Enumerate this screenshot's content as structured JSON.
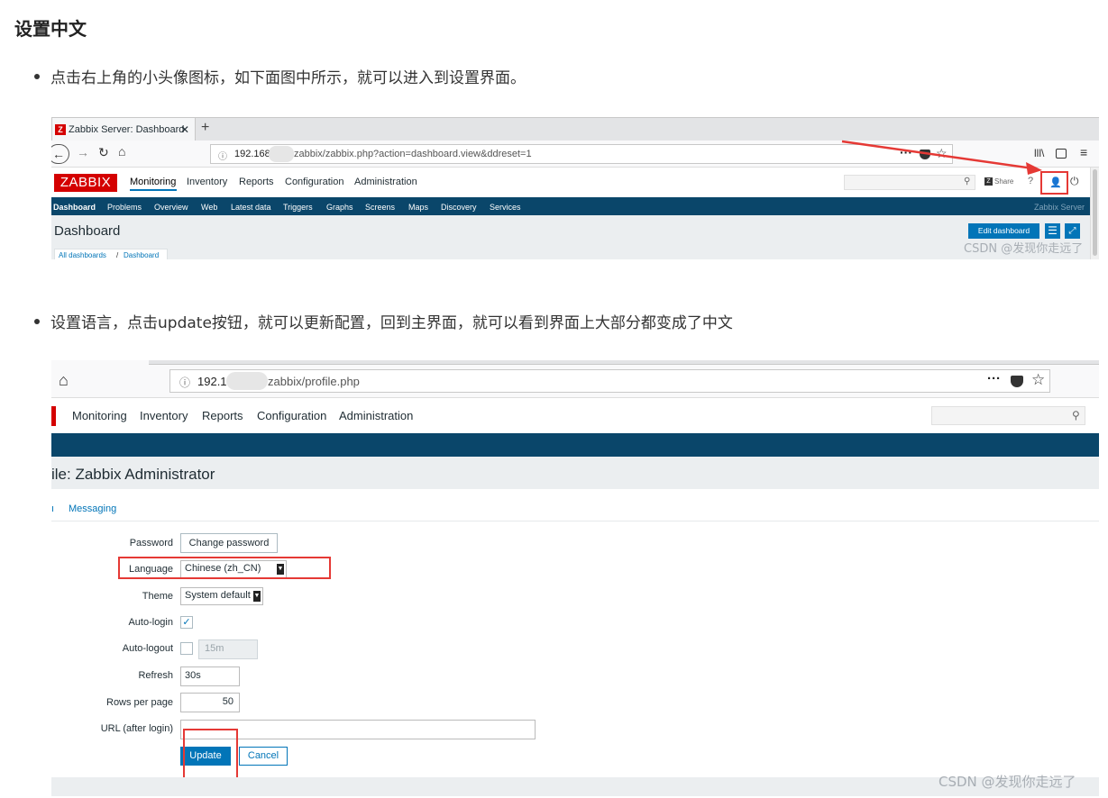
{
  "article": {
    "heading": "设置中文",
    "bullet1": "点击右上角的小头像图标，如下面图中所示，就可以进入到设置界面。",
    "bullet2": "设置语言，点击update按钮，就可以更新配置，回到主界面，就可以看到界面上大部分都变成了中文",
    "watermark": "CSDN @发现你走远了"
  },
  "shot1": {
    "tab_title": "Zabbix Server: Dashboard",
    "tab_close": "✕",
    "tab_new": "+",
    "url_host": "192.168",
    "url_path": "zabbix/zabbix.php?action=dashboard.view&ddreset=1",
    "url_more": "···",
    "logo": "ZABBIX",
    "nav": [
      "Monitoring",
      "Inventory",
      "Reports",
      "Configuration",
      "Administration"
    ],
    "share": "Share",
    "help": "?",
    "subnav": [
      "Dashboard",
      "Problems",
      "Overview",
      "Web",
      "Latest data",
      "Triggers",
      "Graphs",
      "Screens",
      "Maps",
      "Discovery",
      "Services"
    ],
    "server_name": "Zabbix Server",
    "page_title": "Dashboard",
    "edit_button": "Edit dashboard",
    "breadcrumb_all": "All dashboards",
    "breadcrumb_sep": "/",
    "breadcrumb_cur": "Dashboard"
  },
  "shot2": {
    "url_host": "192.1",
    "url_path": "zabbix/profile.php",
    "url_more": "···",
    "nav": [
      "Monitoring",
      "Inventory",
      "Reports",
      "Configuration",
      "Administration"
    ],
    "page_title": "ile: Zabbix Administrator",
    "tab_cut": "ı",
    "tab_messaging": "Messaging",
    "form": {
      "password_label": "Password",
      "password_button": "Change password",
      "language_label": "Language",
      "language_value": "Chinese (zh_CN)",
      "theme_label": "Theme",
      "theme_value": "System default",
      "autologin_label": "Auto-login",
      "autologout_label": "Auto-logout",
      "autologout_value": "15m",
      "refresh_label": "Refresh",
      "refresh_value": "30s",
      "rows_label": "Rows per page",
      "rows_value": "50",
      "url_label": "URL (after login)",
      "url_value": "",
      "update_button": "Update",
      "cancel_button": "Cancel"
    }
  },
  "colors": {
    "zabbix_red": "#d40000",
    "subnav_blue": "#0a466a",
    "primary_button": "#0275b8",
    "annotation_red": "#e53935"
  }
}
